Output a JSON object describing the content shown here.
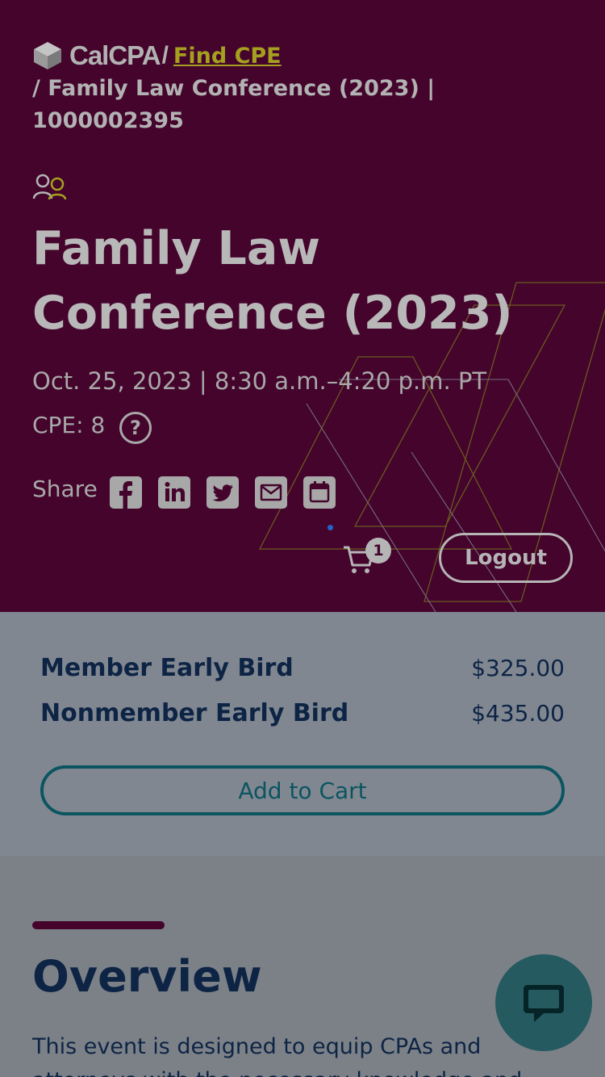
{
  "breadcrumb": {
    "logo_text": "CalCPA",
    "separator": "/",
    "link": "Find CPE",
    "current": "/ Family Law Conference (2023) | 1000002395"
  },
  "event": {
    "title": "Family Law Conference (2023)",
    "date": "Oct. 25, 2023 | 8:30 a.m.–4:20 p.m. PT",
    "cpe": "CPE: 8",
    "help_glyph": "?"
  },
  "share": {
    "label": "Share",
    "icons": [
      "facebook-icon",
      "linkedin-icon",
      "twitter-icon",
      "email-icon",
      "calendar-icon"
    ]
  },
  "header_actions": {
    "cart_count": "1",
    "logout_label": "Logout"
  },
  "pricing": {
    "rows": [
      {
        "label": "Member Early Bird",
        "price": "$325.00"
      },
      {
        "label": "Nonmember Early Bird",
        "price": "$435.00"
      }
    ],
    "add_to_cart_label": "Add to Cart"
  },
  "overview": {
    "heading": "Overview",
    "text": "This event is designed to equip CPAs and attorneys with the necessary knowledge and"
  },
  "colors": {
    "hero_bg": "#44042c",
    "link_accent": "#a5a01f",
    "navy_text": "#0d2444",
    "teal_accent": "#0b5560",
    "chat_bg": "#245a60"
  }
}
